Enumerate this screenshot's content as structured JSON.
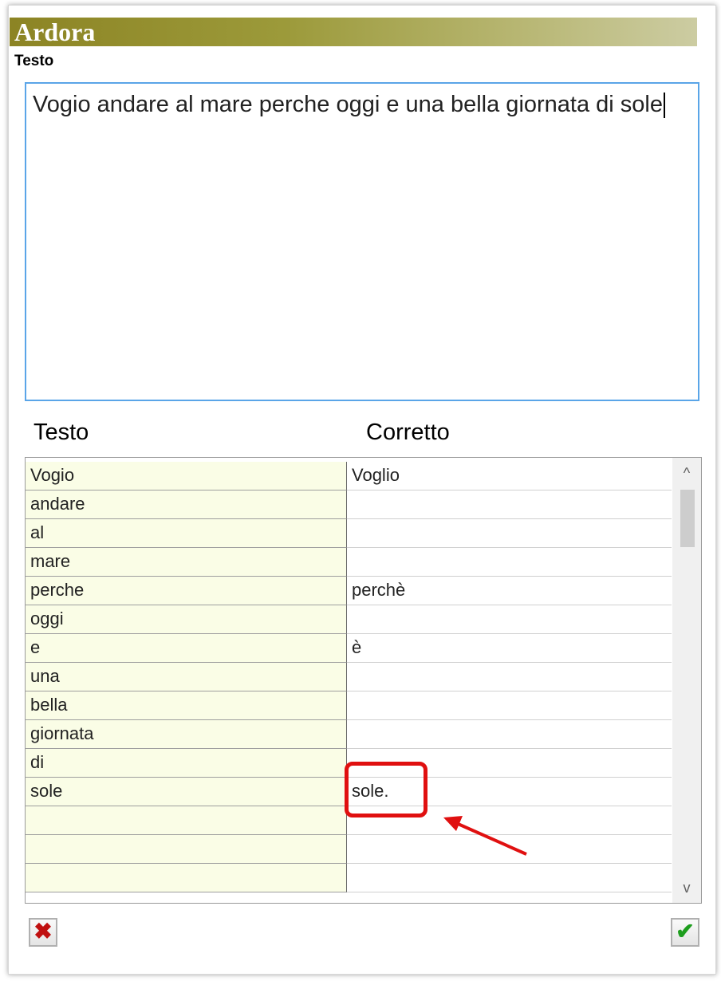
{
  "app": {
    "title": "Ardora"
  },
  "editor": {
    "label": "Testo",
    "content": "Vogio andare al mare perche oggi e una bella giornata di sole"
  },
  "grid": {
    "header_left": "Testo",
    "header_right": "Corretto",
    "rows": [
      {
        "word": "Vogio",
        "correct": "Voglio"
      },
      {
        "word": "andare",
        "correct": ""
      },
      {
        "word": "al",
        "correct": ""
      },
      {
        "word": "mare",
        "correct": ""
      },
      {
        "word": "perche",
        "correct": "perchè"
      },
      {
        "word": "oggi",
        "correct": ""
      },
      {
        "word": "e",
        "correct": "è"
      },
      {
        "word": "una",
        "correct": ""
      },
      {
        "word": "bella",
        "correct": ""
      },
      {
        "word": "giornata",
        "correct": ""
      },
      {
        "word": "di",
        "correct": ""
      },
      {
        "word": "sole",
        "correct": "sole."
      },
      {
        "word": "",
        "correct": ""
      },
      {
        "word": "",
        "correct": ""
      },
      {
        "word": "",
        "correct": ""
      }
    ]
  },
  "buttons": {
    "cancel_icon": "red-x-icon",
    "confirm_icon": "green-check-icon",
    "cancel_glyph": "✖",
    "confirm_glyph": "✔"
  },
  "scroll": {
    "up_glyph": "^",
    "down_glyph": "v"
  },
  "colors": {
    "title_gradient_start": "#8c8424",
    "highlight": "#e01010",
    "word_cell_bg": "#fafde6",
    "focus_border": "#5aa5e8"
  }
}
